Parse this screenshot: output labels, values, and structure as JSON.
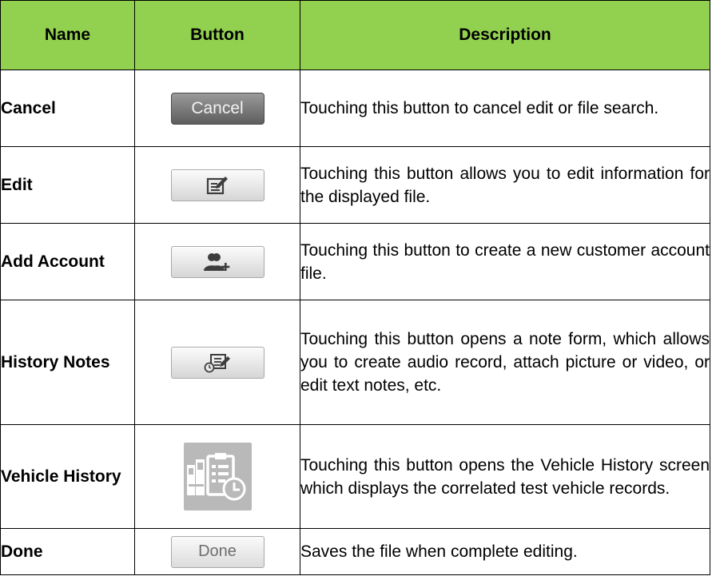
{
  "header": {
    "name": "Name",
    "button": "Button",
    "description": "Description"
  },
  "rows": [
    {
      "name": "Cancel",
      "button_label": "Cancel",
      "description": "Touching this button to cancel edit or file search."
    },
    {
      "name": "Edit",
      "button_icon": "edit-note-icon",
      "description": "Touching this button allows you to edit information for the displayed file."
    },
    {
      "name": "Add Account",
      "button_icon": "add-user-icon",
      "description": "Touching this button to create a new customer account file."
    },
    {
      "name": "History Notes",
      "button_icon": "history-notes-icon",
      "description": "Touching this button opens a note form, which allows you to create audio record, attach picture or video, or edit text notes, etc."
    },
    {
      "name": "Vehicle History",
      "button_icon": "vehicle-history-icon",
      "description": "Touching this button opens the Vehicle History screen which displays the correlated test vehicle records."
    },
    {
      "name": "Done",
      "button_label": "Done",
      "description": "Saves the file when complete editing."
    }
  ],
  "colors": {
    "header_bg": "#92d050",
    "border": "#000000",
    "icon": "#3d3d3d",
    "vehicle_tile": "#b9b9b9"
  }
}
